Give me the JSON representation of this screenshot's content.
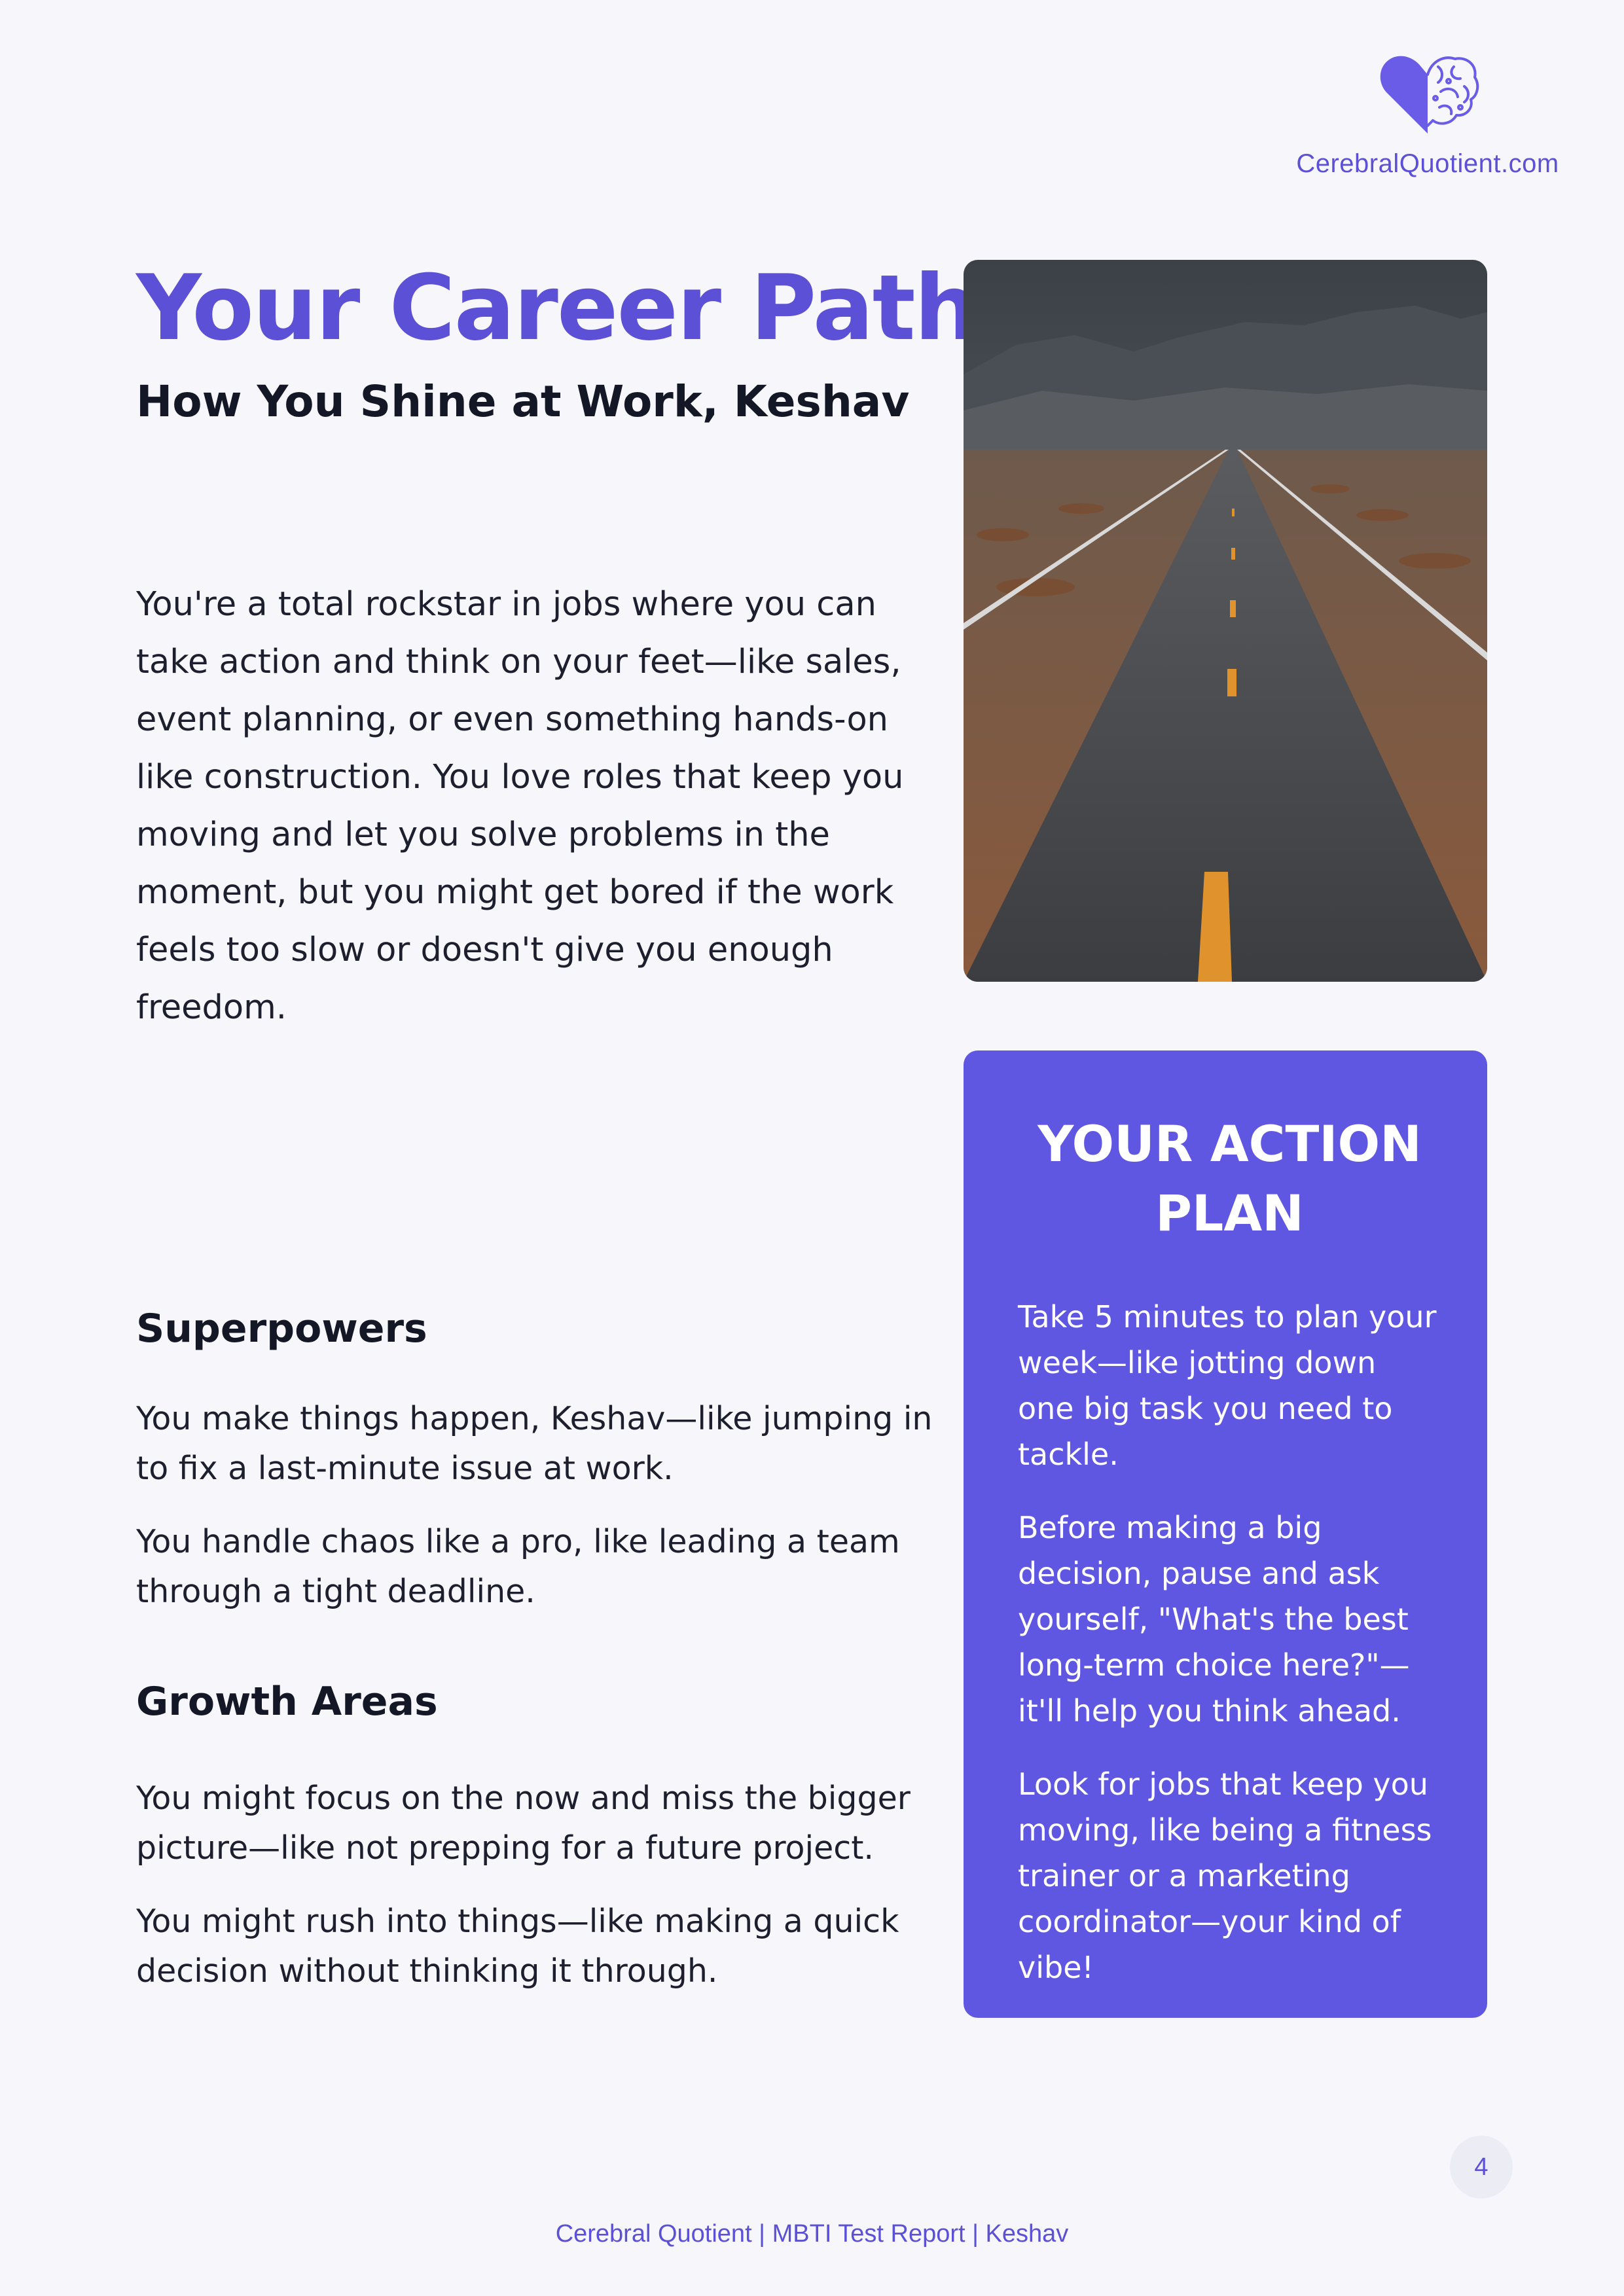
{
  "brand": {
    "logo_icon": "heart-brain-icon",
    "name": "CerebralQuotient.com",
    "color": "#5b50d6"
  },
  "header": {
    "title": "Your Career Path",
    "subtitle": "How You Shine at Work, Keshav"
  },
  "intro": {
    "text": "You're a total rockstar in jobs where you can take action and think on your feet—like sales, event planning, or even something hands-on like construction. You love roles that keep you moving and let you solve problems in the moment, but you might get bored if the work feels too slow or doesn't give you enough freedom."
  },
  "photo": {
    "icon": "open-road-photo"
  },
  "superpowers": {
    "heading": "Superpowers",
    "items": [
      "You make things happen, Keshav—like jumping in to fix a last-minute issue at work.",
      "You handle chaos like a pro, like leading a team through a tight deadline."
    ]
  },
  "growth": {
    "heading": "Growth Areas",
    "items": [
      "You might focus on the now and miss the bigger picture—like not prepping for a future project.",
      "You might rush into things—like making a quick decision without thinking it through."
    ]
  },
  "action_plan": {
    "title": "YOUR ACTION PLAN",
    "background": "#5f57e2",
    "items": [
      "Take 5 minutes to plan your week—like jotting down one big task you need to tackle.",
      "Before making a big decision, pause and ask yourself, \"What's the best long-term choice here?\"—it'll help you think ahead.",
      "Look for jobs that keep you moving, like being a fitness trainer or a marketing coordinator—your kind of vibe!"
    ]
  },
  "page_number": "4",
  "footer": {
    "text": "Cerebral Quotient | MBTI Test Report | Keshav"
  }
}
